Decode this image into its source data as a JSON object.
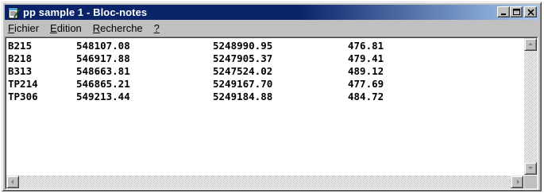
{
  "window": {
    "title": "pp sample 1 - Bloc-notes"
  },
  "menu": {
    "items": [
      {
        "first": "F",
        "rest": "ichier"
      },
      {
        "first": "E",
        "rest": "dition"
      },
      {
        "first": "R",
        "rest": "echerche"
      },
      {
        "first": "?",
        "rest": ""
      }
    ]
  },
  "document": {
    "rows": [
      [
        "B215",
        "548107.08",
        "5248990.95",
        "476.81"
      ],
      [
        "B218",
        "546917.88",
        "5247905.37",
        "479.41"
      ],
      [
        "B313",
        "548663.81",
        "5247524.02",
        "489.12"
      ],
      [
        "TP214",
        "546865.21",
        "5249167.70",
        "477.69"
      ],
      [
        "TP306",
        "549213.44",
        "5249184.88",
        "484.72"
      ]
    ]
  },
  "icons": {
    "app": "notepad-icon",
    "minimize": "minimize-icon",
    "maximize": "maximize-icon",
    "close": "close-icon"
  },
  "colors": {
    "titlebar_start": "#0a246a",
    "titlebar_end": "#a6caf0",
    "face": "#c0c0c0"
  }
}
